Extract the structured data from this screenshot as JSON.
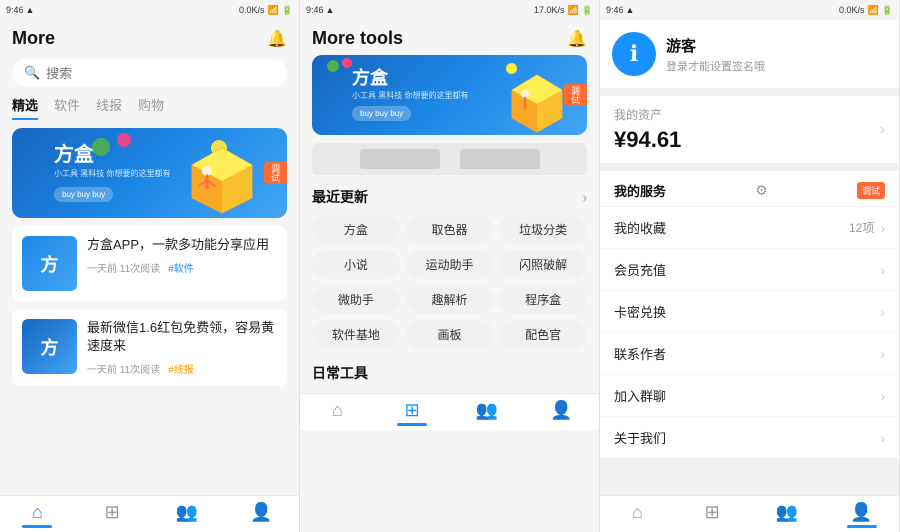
{
  "panels": {
    "p1": {
      "status": "9:46",
      "title": "More",
      "bell": "🔔",
      "search_placeholder": "搜索",
      "tabs": [
        "精选",
        "软件",
        "线报",
        "购物"
      ],
      "active_tab": 0,
      "banner": {
        "title": "方盒",
        "subtitle": "小工具 黑科技 你想要的这里都有",
        "btn": "buy buy buy"
      },
      "articles": [
        {
          "title": "方盒APP，一款多功能分享应用",
          "meta": "一天前 11次阅读",
          "tag": "#软件",
          "tag_color": "blue"
        },
        {
          "title": "最新微信1.6红包免费领，容易黄速度来",
          "meta": "一天前 11次阅读",
          "tag": "#线报",
          "tag_color": "orange"
        }
      ],
      "nav": [
        "home",
        "grid",
        "users",
        "user"
      ]
    },
    "p2": {
      "status": "9:46",
      "title": "More tools",
      "bell": "🔔",
      "banner": {
        "title": "方盒",
        "subtitle": "小工具 黑科技 你想要的这里都有",
        "btn": "buy buy buy"
      },
      "recent_label": "最近更新",
      "tools": [
        "方盒",
        "取色器",
        "垃圾分类",
        "小说",
        "运动助手",
        "闪照破解",
        "微助手",
        "趣解析",
        "程序盒",
        "软件基地",
        "画板",
        "配色官"
      ],
      "daily_label": "日常工具",
      "nav": [
        "home",
        "grid",
        "users",
        "user"
      ]
    },
    "p3": {
      "status": "9:46",
      "username": "游客",
      "login_hint": "登录才能设置签名哦",
      "assets_label": "我的资产",
      "assets_value": "¥94.61",
      "services_label": "我的服务",
      "services": [
        {
          "label": "我的收藏",
          "count": "12项",
          "has_arrow": true
        },
        {
          "label": "会员充值",
          "has_arrow": true
        },
        {
          "label": "卡密兑换",
          "has_arrow": true
        },
        {
          "label": "联系作者",
          "has_arrow": true
        },
        {
          "label": "加入群聊",
          "has_arrow": true
        },
        {
          "label": "关于我们",
          "has_arrow": true
        }
      ],
      "nav": [
        "home",
        "grid",
        "users",
        "user"
      ]
    }
  }
}
